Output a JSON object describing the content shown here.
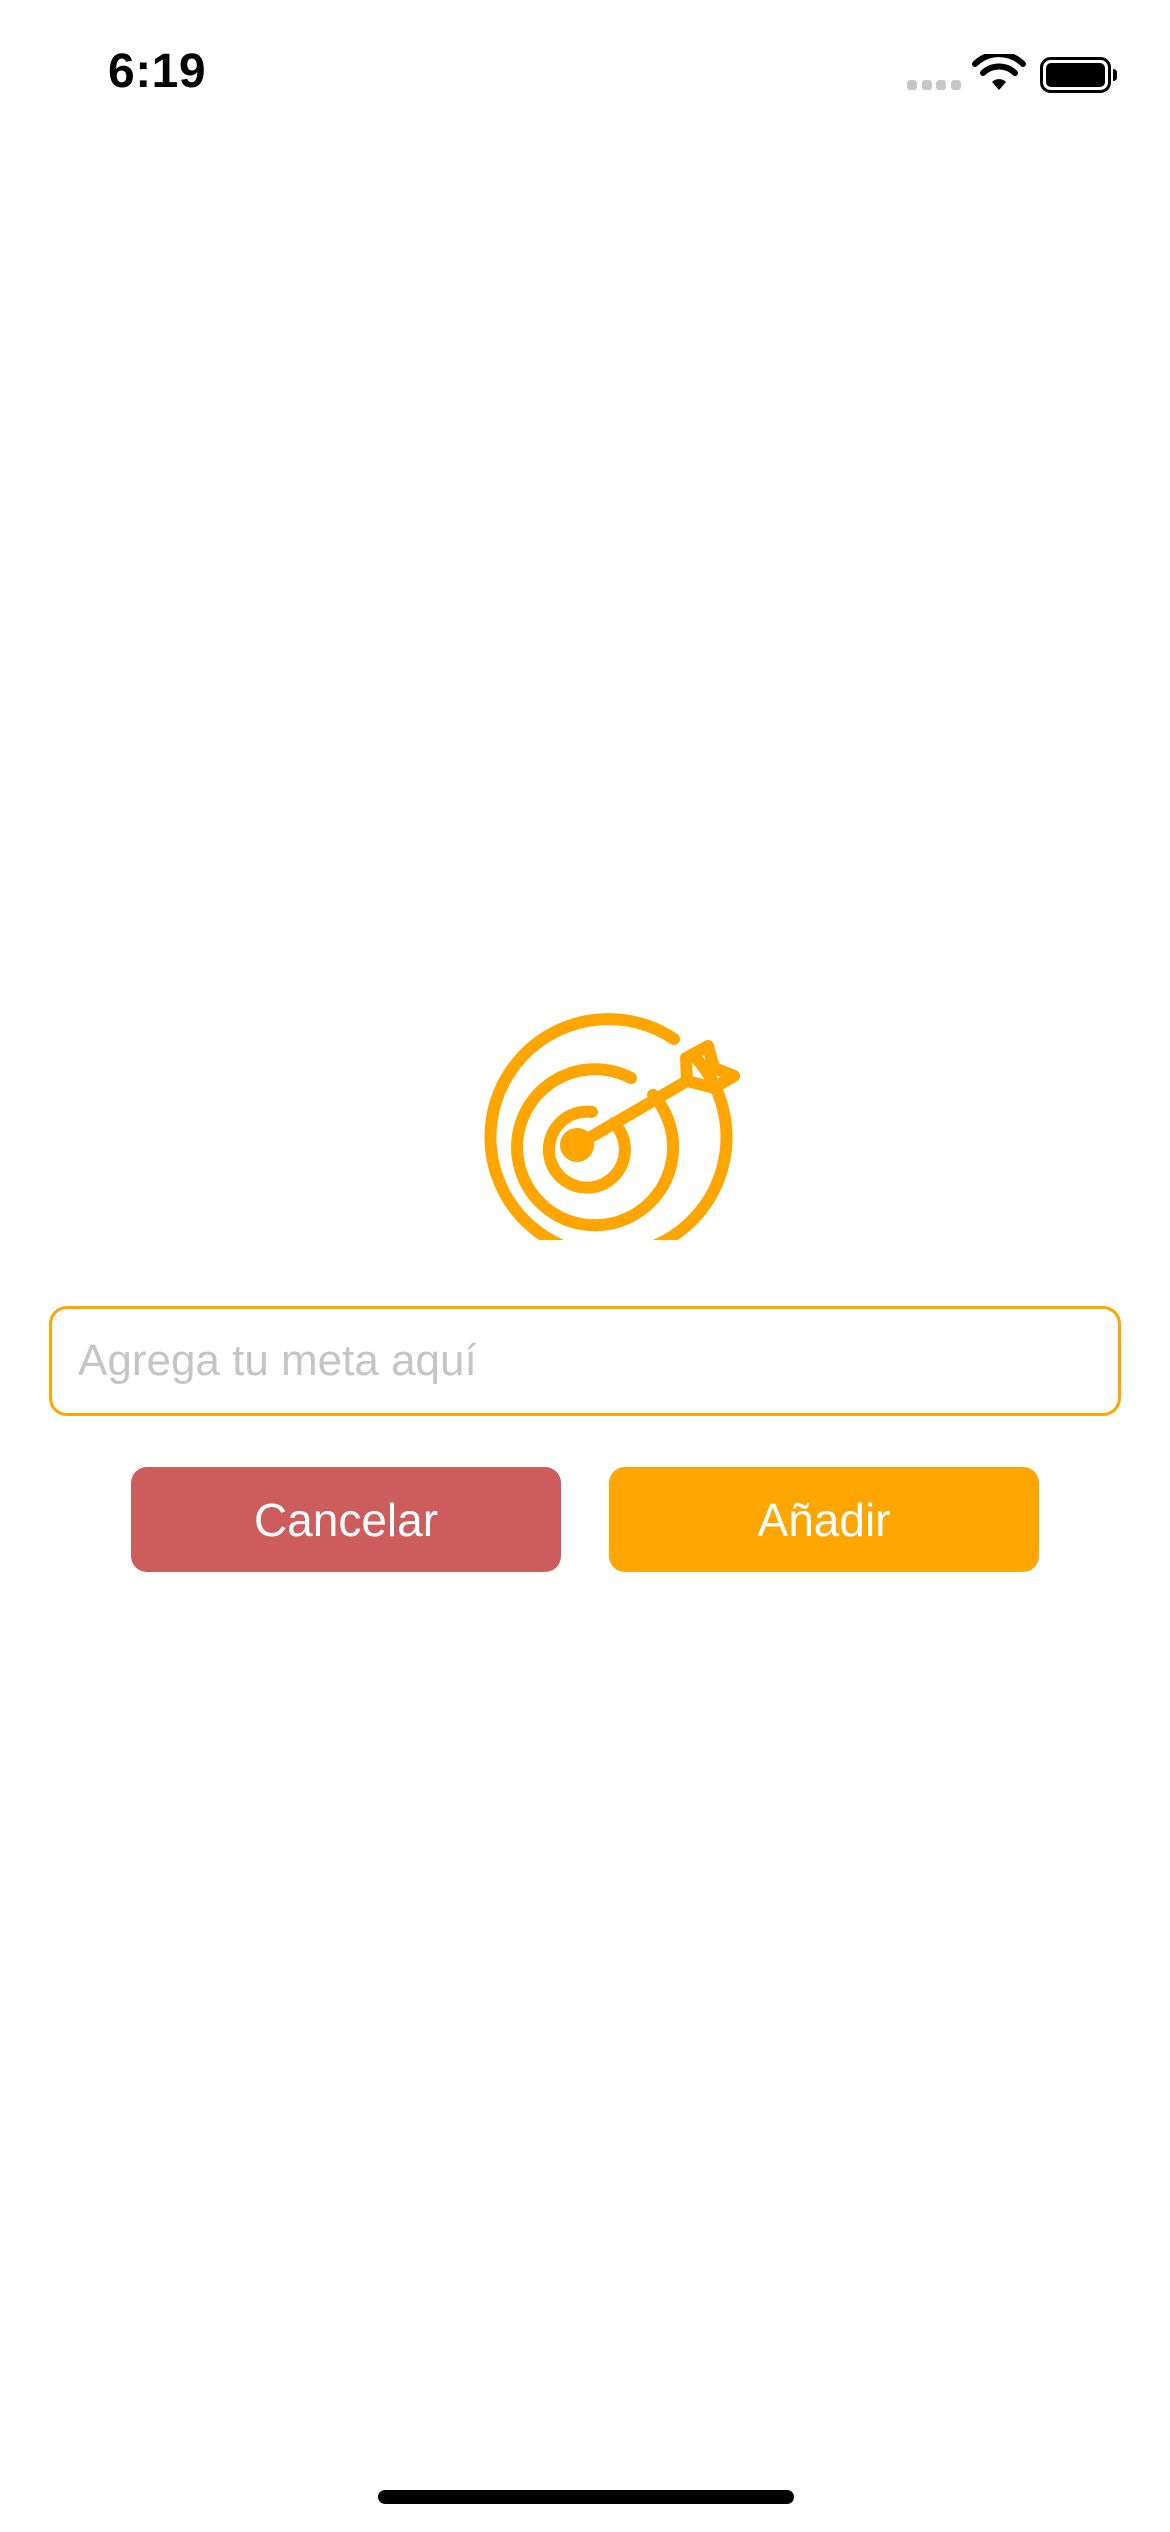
{
  "status_bar": {
    "time": "6:19",
    "signal_icon": "cellular-signal-icon",
    "wifi_icon": "wifi-icon",
    "battery_icon": "battery-icon"
  },
  "hero": {
    "icon": "target-arrow-icon",
    "accent_color": "#ffa500"
  },
  "goal_form": {
    "input_value": "",
    "input_placeholder": "Agrega tu meta aquí",
    "cancel_label": "Cancelar",
    "cancel_color": "#cd5c5c",
    "add_label": "Añadir",
    "add_color": "#ffa500"
  }
}
